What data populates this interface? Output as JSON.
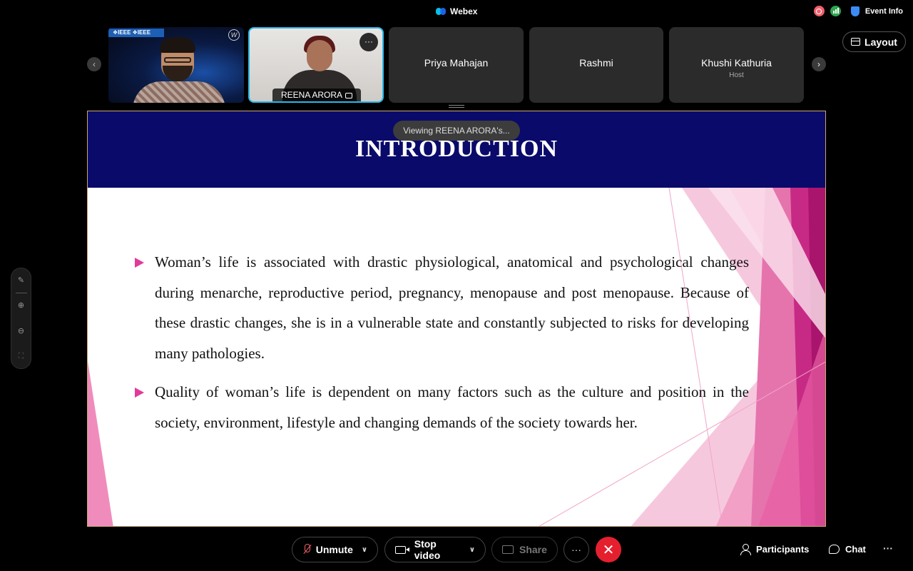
{
  "window": {
    "title": "Webex"
  },
  "top_right": {
    "event_info_label": "Event Info"
  },
  "strip": {
    "participants": [
      {
        "name": "REENA ARORA"
      },
      {
        "name": "Priya Mahajan",
        "role": ""
      },
      {
        "name": "Rashmi",
        "role": ""
      },
      {
        "name": "Khushi Kathuria",
        "role": "Host"
      }
    ],
    "ieee_banner": "❖IEEE ❖IEEE",
    "more_glyph": "···"
  },
  "layout_button": {
    "label": "Layout"
  },
  "viewing_tooltip": "Viewing REENA ARORA's...",
  "slide": {
    "title": "INTRODUCTION",
    "bullets": [
      "Woman’s life is associated with drastic physiological, anatomical and psychological changes during menarche, reproductive period, pregnancy, menopause and post menopause. Because of these drastic changes, she is in a vulnerable state and constantly subjected to risks for developing many pathologies.",
      " Quality of woman’s life is dependent on many factors such as the culture and position in the society, environment, lifestyle and changing demands of the society towards her."
    ],
    "accent_color": "#e23a9a",
    "header_color": "#0a0a6b"
  },
  "controls": {
    "unmute_label": "Unmute",
    "stop_video_label": "Stop video",
    "share_label": "Share",
    "more_glyph": "···",
    "end_glyph": "✕",
    "participants_label": "Participants",
    "chat_label": "Chat",
    "overflow_glyph": "···"
  },
  "icons": {
    "side_tools": [
      "annotate-icon",
      "zoom-in-icon",
      "zoom-out-icon",
      "fit-icon"
    ]
  },
  "colors": {
    "active_tile_border": "#2bb6e8",
    "end_call": "#e5202e",
    "muted_mic": "#f25f6b"
  }
}
